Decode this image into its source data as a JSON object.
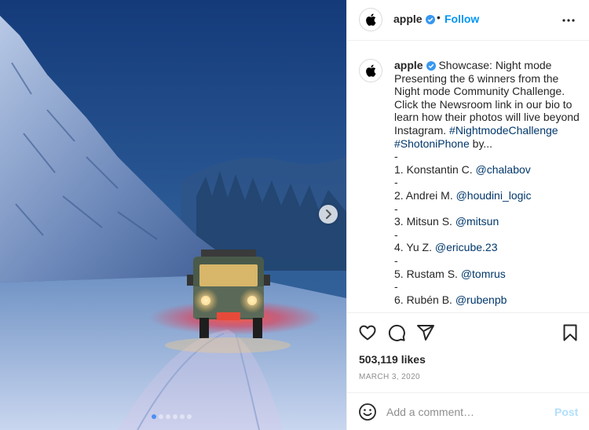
{
  "post": {
    "carousel": {
      "slide_count": 6,
      "active_index": 0
    },
    "header": {
      "avatar_icon": "apple-logo-icon",
      "username": "apple",
      "verified_icon": "verified-badge-icon",
      "separator": "•",
      "follow_label": "Follow",
      "more_icon": "more-options-icon"
    },
    "caption": {
      "username": "apple",
      "line1": "Showcase: Night mode",
      "line2": "Presenting the 6 winners from the",
      "line3": "Night mode Community Challenge.",
      "line4": "Click the Newsroom link in our bio to",
      "line5": "learn how their photos will live beyond",
      "line6_prefix": "Instagram.",
      "hashtag1": "#NightmodeChallenge",
      "hashtag2": "#ShotoniPhone",
      "by_text": "by...",
      "dash": "-",
      "winners": [
        {
          "label": "1. Konstantin C.",
          "handle": "@chalabov"
        },
        {
          "label": "2. Andrei M.",
          "handle": "@houdini_logic"
        },
        {
          "label": "3. Mitsun S.",
          "handle": "@mitsun"
        },
        {
          "label": "4. Yu Z.",
          "handle": "@ericube.23"
        },
        {
          "label": "5. Rustam S.",
          "handle": "@tomrus"
        },
        {
          "label": "6. Rubén B.",
          "handle": "@rubenpb"
        }
      ]
    },
    "actions": {
      "like_icon": "heart-icon",
      "comment_icon": "comment-icon",
      "share_icon": "share-icon",
      "save_icon": "bookmark-icon"
    },
    "likes": "503,119 likes",
    "date": "MARCH 3, 2020",
    "comment": {
      "emoji_icon": "emoji-icon",
      "placeholder": "Add a comment…",
      "value": "",
      "post_label": "Post"
    }
  },
  "colors": {
    "accent": "#0095f6",
    "hashtag": "#00376b",
    "post_disabled": "#b2dffc",
    "muted": "#8e8e8e",
    "carousel_active": "#4c8ef5"
  }
}
